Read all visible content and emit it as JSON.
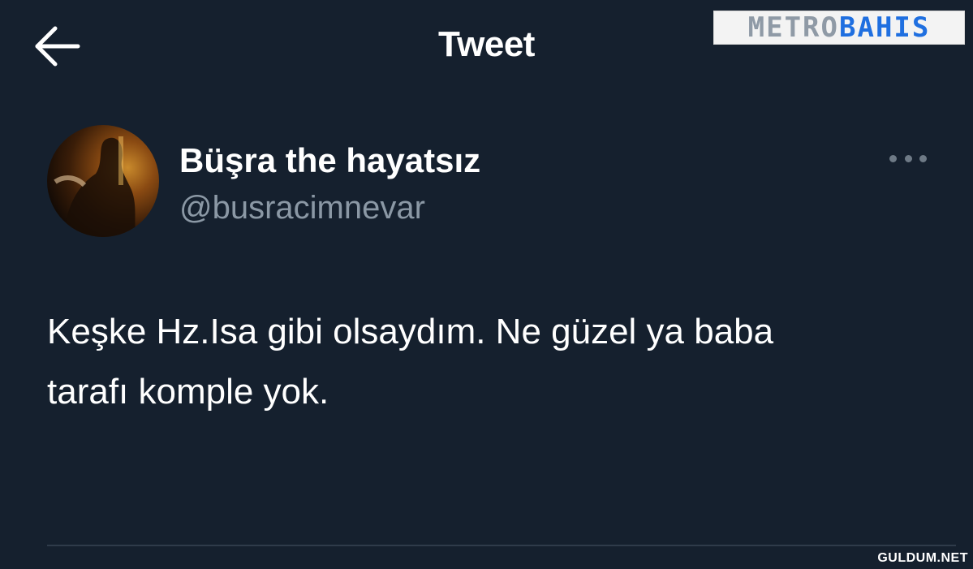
{
  "header": {
    "title": "Tweet",
    "back_icon": "arrow-left-icon"
  },
  "watermark": {
    "part_a": "METRO",
    "part_b": "BAHIS"
  },
  "author": {
    "display_name": "Büşra the hayatsız",
    "handle": "@busracimnevar",
    "more_icon": "more-horizontal-icon"
  },
  "tweet": {
    "line1": "Keşke Hz.Isa gibi olsaydım. Ne güzel ya baba",
    "line2": "tarafı komple yok."
  },
  "footer_credit": "GULDUM.NET",
  "colors": {
    "background": "#15202e",
    "text_primary": "#ffffff",
    "text_secondary": "#8b98a5",
    "watermark_blue": "#1f6fe0"
  }
}
